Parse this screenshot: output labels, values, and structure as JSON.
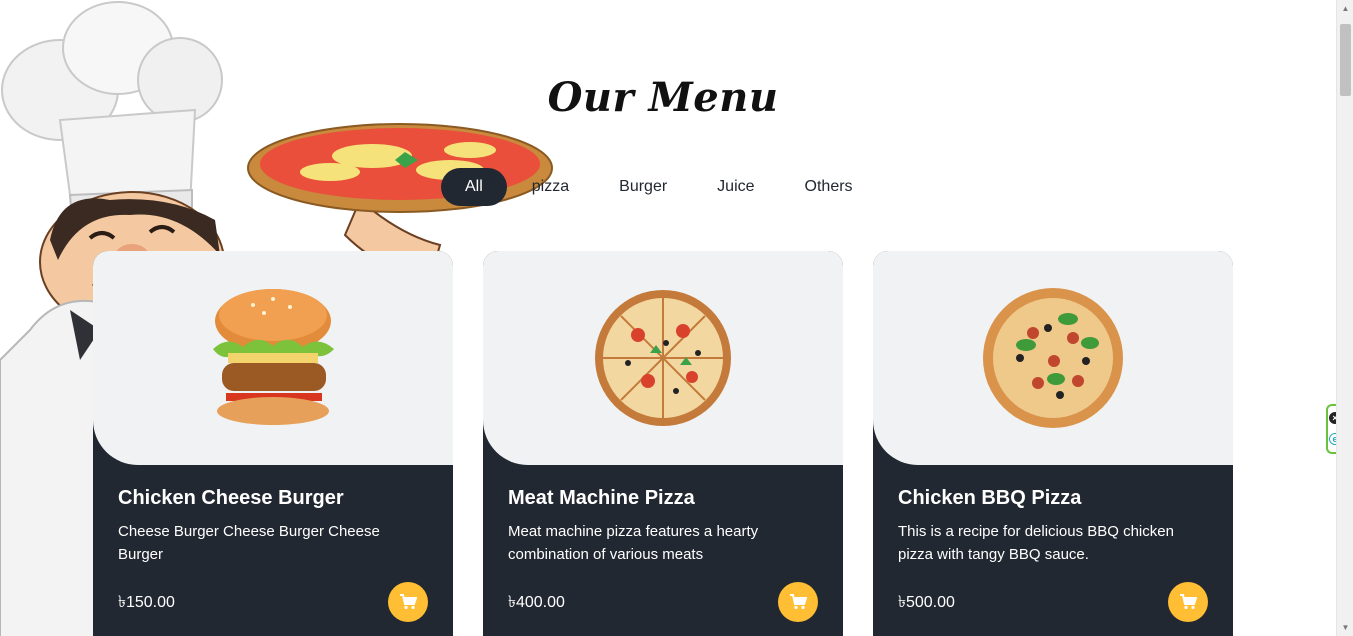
{
  "section": {
    "title": "Our Menu"
  },
  "filters": [
    {
      "label": "All",
      "active": true
    },
    {
      "label": "pizza",
      "active": false
    },
    {
      "label": "Burger",
      "active": false
    },
    {
      "label": "Juice",
      "active": false
    },
    {
      "label": "Others",
      "active": false
    }
  ],
  "items": [
    {
      "name": "Chicken Cheese Burger",
      "description": "Cheese Burger Cheese Burger Cheese Burger",
      "price": "৳150.00",
      "image": "burger-image"
    },
    {
      "name": "Meat Machine Pizza",
      "description": "Meat machine pizza features a hearty combination of various meats",
      "price": "৳400.00",
      "image": "pizza-image"
    },
    {
      "name": "Chicken BBQ Pizza",
      "description": "This is a recipe for delicious BBQ chicken pizza with tangy BBQ sauce.",
      "price": "৳500.00",
      "image": "pizza-image"
    }
  ],
  "colors": {
    "dark": "#222831",
    "accent": "#ffbe33",
    "card_top": "#f1f2f3"
  },
  "icons": {
    "cart": "cart-icon",
    "decor": "chef-illustration"
  }
}
